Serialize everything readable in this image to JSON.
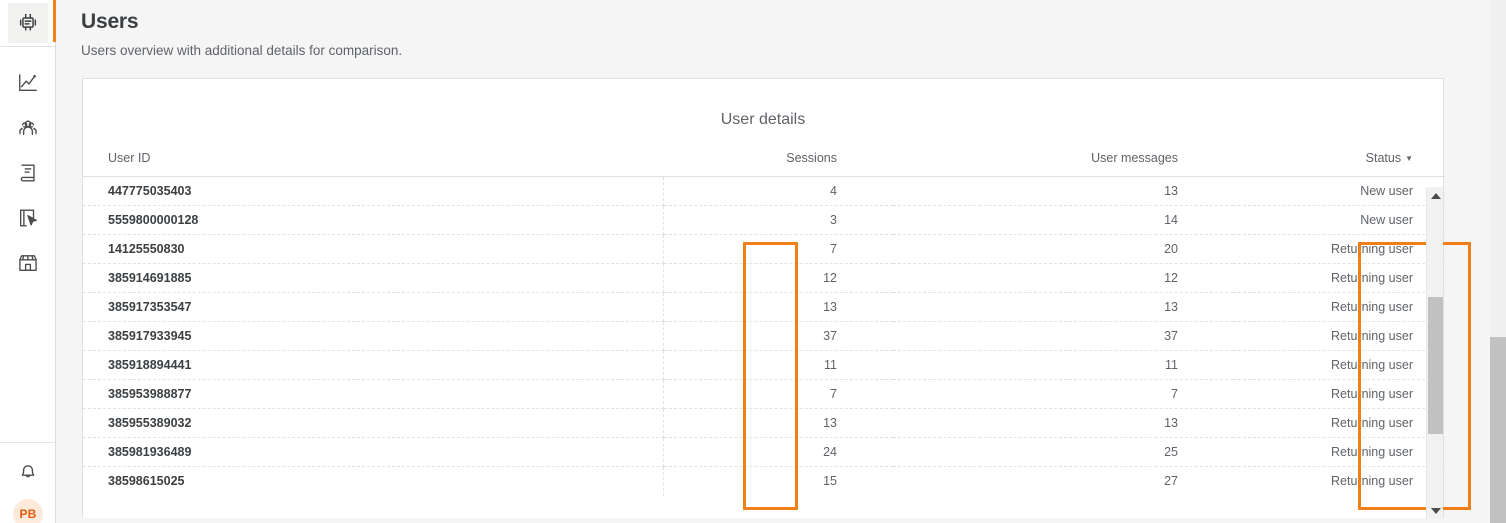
{
  "sidebar": {
    "brand_icon": "robot-icon",
    "accent_color": "#f07f1a",
    "nav": [
      {
        "icon": "analytics-chart-icon",
        "name": "analytics"
      },
      {
        "icon": "users-group-icon",
        "name": "users"
      },
      {
        "icon": "book-icon",
        "name": "knowledge-base"
      },
      {
        "icon": "cursor-click-icon",
        "name": "actions"
      },
      {
        "icon": "storefront-icon",
        "name": "marketplace"
      }
    ],
    "bell_icon": "bell-icon",
    "avatar_initials": "PB"
  },
  "header": {
    "title": "Users",
    "subtitle": "Users overview with additional details for comparison."
  },
  "card": {
    "title": "User details"
  },
  "table": {
    "columns": [
      {
        "key": "user_id",
        "label": "User ID"
      },
      {
        "key": "sessions",
        "label": "Sessions"
      },
      {
        "key": "user_messages",
        "label": "User messages"
      },
      {
        "key": "status",
        "label": "Status",
        "sorted": true,
        "sort_caret": "▼"
      }
    ],
    "rows": [
      {
        "user_id": "447775035403",
        "sessions": "4",
        "user_messages": "13",
        "status": "New user"
      },
      {
        "user_id": "5559800000128",
        "sessions": "3",
        "user_messages": "14",
        "status": "New user"
      },
      {
        "user_id": "14125550830",
        "sessions": "7",
        "user_messages": "20",
        "status": "Returning user"
      },
      {
        "user_id": "385914691885",
        "sessions": "12",
        "user_messages": "12",
        "status": "Returning user"
      },
      {
        "user_id": "385917353547",
        "sessions": "13",
        "user_messages": "13",
        "status": "Returning user"
      },
      {
        "user_id": "385917933945",
        "sessions": "37",
        "user_messages": "37",
        "status": "Returning user"
      },
      {
        "user_id": "385918894441",
        "sessions": "11",
        "user_messages": "11",
        "status": "Returning user"
      },
      {
        "user_id": "385953988877",
        "sessions": "7",
        "user_messages": "7",
        "status": "Returning user"
      },
      {
        "user_id": "385955389032",
        "sessions": "13",
        "user_messages": "13",
        "status": "Returning user"
      },
      {
        "user_id": "385981936489",
        "sessions": "24",
        "user_messages": "25",
        "status": "Returning user"
      },
      {
        "user_id": "38598615025",
        "sessions": "15",
        "user_messages": "27",
        "status": "Returning user"
      }
    ]
  },
  "highlights": {
    "color": "#f07f1a",
    "regions": [
      {
        "name": "sessions-column-highlight",
        "column": "sessions",
        "from_row": 3,
        "to_row": 11
      },
      {
        "name": "status-column-highlight",
        "column": "status",
        "from_row": 3,
        "to_row": 11
      }
    ]
  },
  "scrollbars": {
    "table": {
      "up_arrow": "▲",
      "down_arrow": "▼"
    },
    "page": {
      "visible": true
    }
  }
}
